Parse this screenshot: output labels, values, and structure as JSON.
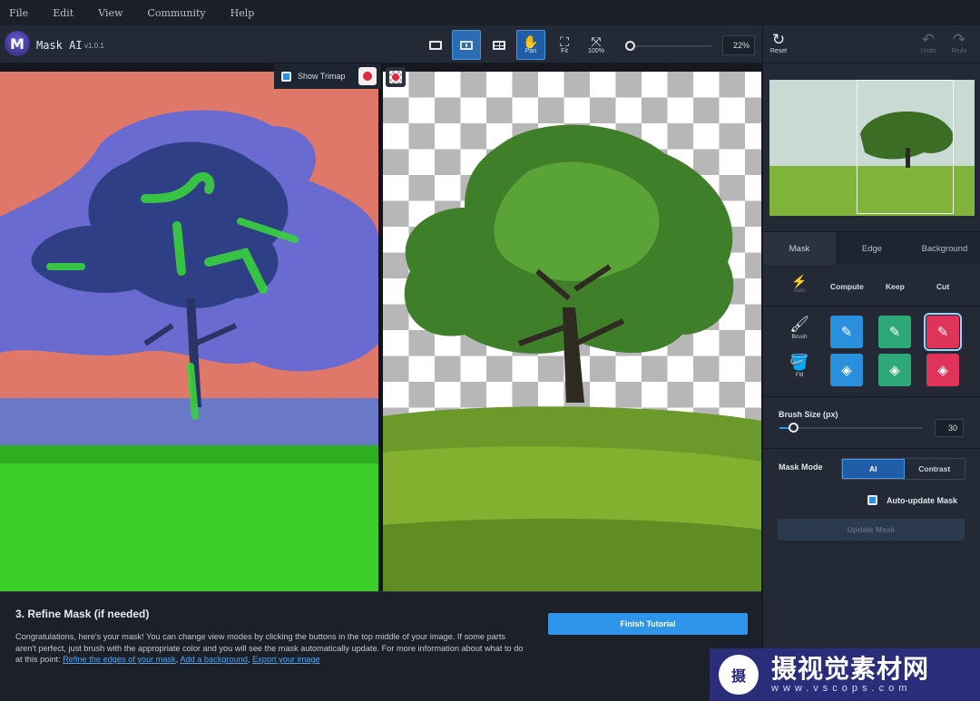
{
  "menu": [
    "File",
    "Edit",
    "View",
    "Community",
    "Help"
  ],
  "app": {
    "name": "Mask AI",
    "version": "v1.0.1",
    "logo_letter": "M"
  },
  "toolbar": {
    "pan_label": "Pan",
    "fit_label": "Fit",
    "actual_label": "100%",
    "zoom_value": "22%",
    "reset_label": "Reset",
    "undo_label": "Undo",
    "redo_label": "Redo"
  },
  "trimap": {
    "label": "Show Trimap"
  },
  "tutorial": {
    "title": "3. Refine Mask (if needed)",
    "body": "Congratulations, here's your mask! You can change view modes by clicking the buttons in the top middle of your image. If some parts aren't perfect, just brush with the appropriate color and you will see the mask automatically update. For more information about what to do at this point: ",
    "link1": "Refine the edges of your mask",
    "link2": "Add a background",
    "link3": "Export your image",
    "finish_label": "Finish Tutorial"
  },
  "sidebar": {
    "tabs": [
      "Mask",
      "Edge",
      "Background"
    ],
    "auto_label": "Auto",
    "modes": [
      "Compute",
      "Keep",
      "Cut"
    ],
    "brush_label": "Brush",
    "fill_label": "Fill",
    "brush_size_label": "Brush Size (px)",
    "brush_size_value": "30",
    "mask_mode_label": "Mask Mode",
    "mask_mode_options": [
      "AI",
      "Contrast"
    ],
    "mask_mode_selected": "AI",
    "auto_update_label": "Auto-update Mask",
    "update_label": "Update Mask"
  },
  "watermark": {
    "text": "摄视觉素材网",
    "url": "www.vscops.com",
    "logo": "摄"
  },
  "colors": {
    "accent": "#2e95ea",
    "keep": "#2ea877",
    "cut": "#e0335a",
    "compute": "#2a8fdc"
  }
}
